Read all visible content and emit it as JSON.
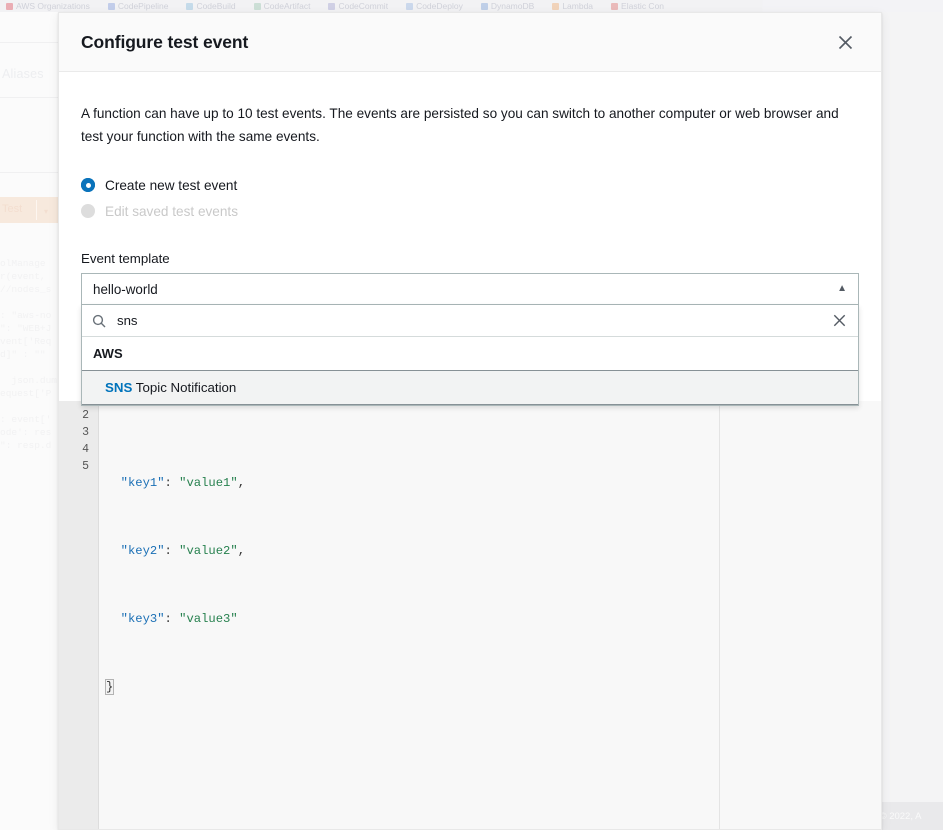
{
  "background": {
    "bookmarks": [
      {
        "label": "AWS Organizations",
        "color": "#e8a0a8"
      },
      {
        "label": "CodePipeline",
        "color": "#b9c6e8"
      },
      {
        "label": "CodeBuild",
        "color": "#bcd6e8"
      },
      {
        "label": "CodeArtifact",
        "color": "#c5dbd0"
      },
      {
        "label": "CodeCommit",
        "color": "#c9c9e2"
      },
      {
        "label": "CodeDeploy",
        "color": "#c3d3ea"
      },
      {
        "label": "DynamoDB",
        "color": "#b5c8e6"
      },
      {
        "label": "Lambda",
        "color": "#f0cdb0"
      },
      {
        "label": "Elastic Con",
        "color": "#e8b0b0"
      }
    ],
    "aliases_label": "Aliases",
    "test_button_label": "Test",
    "test_button_caret": "▾",
    "code_snippet": "olManage\nr(event,\n//nodes_s\n\n: \"aws-no\n\": \"WEB+J\nvent['Req\nd]\" : \"\"\n\n  json.dum\nequest['P\n\n: event['\node': res\n\": resp.d",
    "footer_text": "© 2022, A"
  },
  "modal": {
    "title": "Configure test event",
    "close_icon": "close-icon",
    "intro_text": "A function can have up to 10 test events. The events are persisted so you can switch to another computer or web browser and test your function with the same events.",
    "radio_options": [
      {
        "label": "Create new test event",
        "selected": true,
        "disabled": false
      },
      {
        "label": "Edit saved test events",
        "selected": false,
        "disabled": true
      }
    ],
    "field_label": "Event template",
    "select": {
      "value": "hello-world",
      "caret": "▲",
      "expanded": true
    },
    "search": {
      "value": "sns",
      "placeholder": "",
      "icon": "search-icon",
      "clear_icon": "close-icon"
    },
    "dropdown": {
      "groups": [
        {
          "header": "AWS",
          "options": [
            {
              "match": "SNS",
              "rest": " Topic Notification",
              "highlighted": true
            }
          ]
        }
      ]
    }
  },
  "editor": {
    "line_numbers": [
      "2",
      "3",
      "4",
      "5"
    ],
    "lines": [
      {
        "indent": "  ",
        "key": "\"key1\"",
        "colon": ": ",
        "value": "\"value1\"",
        "trail": ","
      },
      {
        "indent": "  ",
        "key": "\"key2\"",
        "colon": ": ",
        "value": "\"value2\"",
        "trail": ","
      },
      {
        "indent": "  ",
        "key": "\"key3\"",
        "colon": ": ",
        "value": "\"value3\"",
        "trail": ""
      },
      {
        "indent": "",
        "key": "",
        "colon": "",
        "value": "",
        "trail": "}"
      }
    ]
  },
  "colors": {
    "accent": "#0073bb",
    "radio_on": "#0a73bb",
    "json_key": "#1a6fb5",
    "json_string": "#27814f",
    "border": "#aab7b8"
  }
}
